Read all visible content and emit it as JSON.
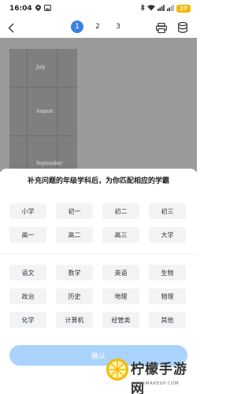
{
  "status_bar": {
    "time": "16:04",
    "battery": "27"
  },
  "toolbar": {
    "pages": [
      "1",
      "2",
      "3"
    ],
    "active_page": "1"
  },
  "photo": {
    "words": [
      "July",
      "August",
      "September"
    ]
  },
  "sheet": {
    "title": "补充问题的年级学科后，为你匹配相应的学霸",
    "grades": [
      "小学",
      "初一",
      "初二",
      "初三",
      "高一",
      "高二",
      "高三",
      "大学"
    ],
    "subjects": [
      "语文",
      "数学",
      "英语",
      "生物",
      "政治",
      "历史",
      "地理",
      "物理",
      "化学",
      "计算机",
      "经管类",
      "其他"
    ],
    "confirm_label": "确认"
  },
  "watermark": {
    "brand": "柠檬手游网",
    "domain": "NINGMAKEUP.COM"
  },
  "colors": {
    "accent": "#3b82e0",
    "confirm_bg": "#a9d3fb",
    "chip_bg": "#f2f3f5",
    "battery": "#f5b800"
  }
}
